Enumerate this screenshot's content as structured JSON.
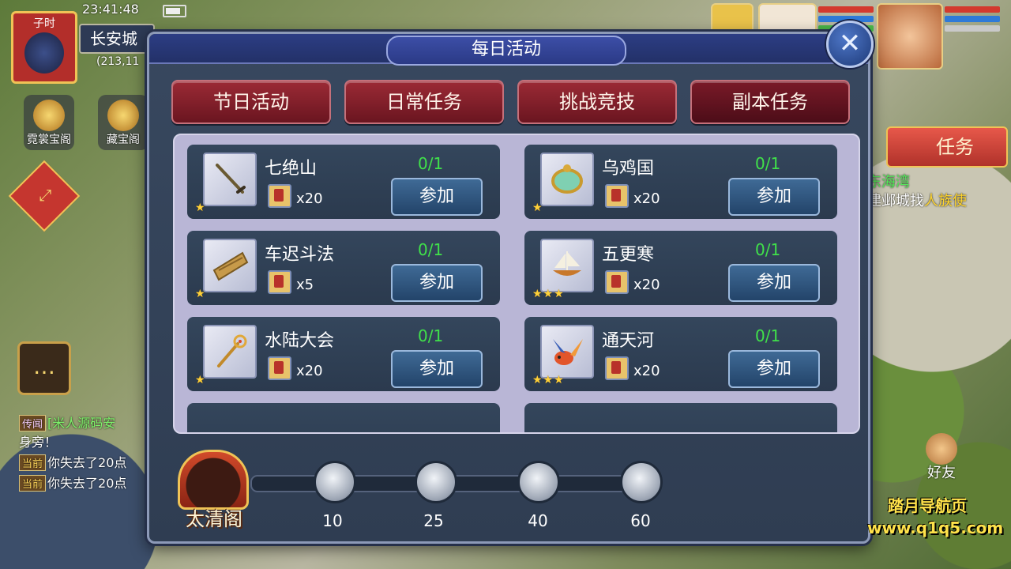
{
  "hud": {
    "clock": "23:41:48",
    "time_period": "子时",
    "map_name": "长安城",
    "coords": "(213,11",
    "side_buttons": [
      "霓裳宝阁",
      "藏宝阁"
    ],
    "task_button": "任务",
    "quest_location": "东海湾",
    "quest_text_prefix": "建邺城找",
    "quest_text_target": "人族使",
    "friend_button": "好友",
    "chat_icon": "chat-bubble-icon",
    "chat_lines": [
      {
        "tag": "传闻",
        "text": "米人源码安",
        "prefix": "[",
        "kind": "rumor"
      },
      {
        "tag": "",
        "text": "身旁！",
        "prefix": "",
        "kind": "plain"
      },
      {
        "tag": "当前",
        "text": "你失去了20点",
        "prefix": "",
        "kind": "current"
      },
      {
        "tag": "当前",
        "text": "你失去了20点",
        "prefix": "",
        "kind": "current"
      }
    ]
  },
  "watermark": {
    "line1": "踏月导航页",
    "line2": "www.q1q5.com"
  },
  "dialog": {
    "title": "每日活动",
    "close_glyph": "✕",
    "tabs": [
      {
        "label": "节日活动"
      },
      {
        "label": "日常任务"
      },
      {
        "label": "挑战竞技"
      },
      {
        "label": "副本任务"
      }
    ],
    "entries": [
      {
        "name": "七绝山",
        "progress": "0/1",
        "reward_qty": "x20",
        "button": "参加",
        "stars": 1,
        "icon": "sword-icon"
      },
      {
        "name": "乌鸡国",
        "progress": "0/1",
        "reward_qty": "x20",
        "button": "参加",
        "stars": 1,
        "icon": "jade-mirror-icon"
      },
      {
        "name": "车迟斗法",
        "progress": "0/1",
        "reward_qty": "x5",
        "button": "参加",
        "stars": 1,
        "icon": "scroll-icon"
      },
      {
        "name": "五更寒",
        "progress": "0/1",
        "reward_qty": "x20",
        "button": "参加",
        "stars": 3,
        "icon": "ship-icon"
      },
      {
        "name": "水陆大会",
        "progress": "0/1",
        "reward_qty": "x20",
        "button": "参加",
        "stars": 1,
        "icon": "staff-icon"
      },
      {
        "name": "通天河",
        "progress": "0/1",
        "reward_qty": "x20",
        "button": "参加",
        "stars": 3,
        "icon": "fish-icon"
      }
    ],
    "pavilion": {
      "label": "太清阁",
      "milestones": [
        "10",
        "25",
        "40",
        "60"
      ]
    }
  },
  "colors": {
    "progress_green": "#40e14a",
    "tab_red": "#9b2a35",
    "button_blue": "#3f6a96",
    "star_gold": "#ffd23a"
  }
}
